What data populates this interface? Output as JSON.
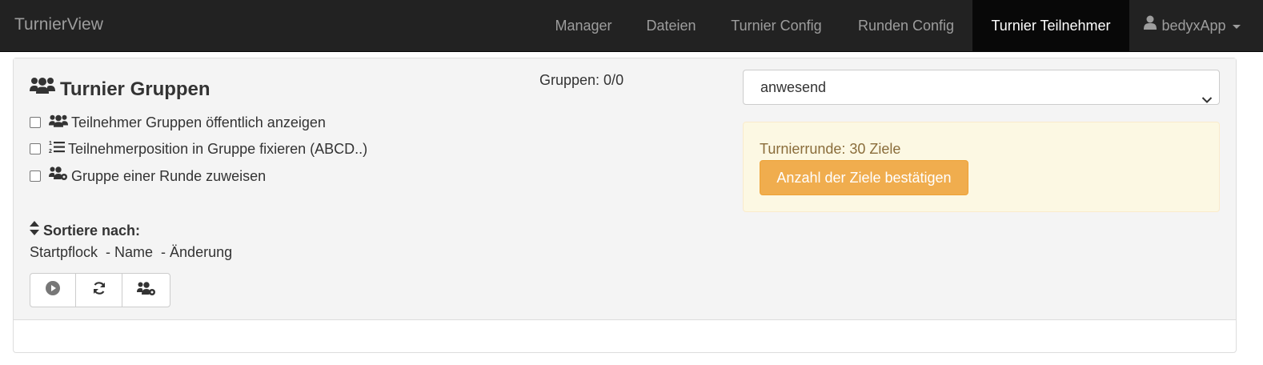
{
  "navbar": {
    "brand": "TurnierView",
    "items": [
      {
        "label": "Manager"
      },
      {
        "label": "Dateien"
      },
      {
        "label": "Turnier Config"
      },
      {
        "label": "Runden Config"
      },
      {
        "label": "Turnier Teilnehmer",
        "active": true
      }
    ],
    "user": {
      "label": "bedyxApp",
      "icon": "user-icon"
    }
  },
  "main": {
    "title": "Turnier Gruppen",
    "title_icon": "users-icon",
    "groups_count": "Gruppen: 0/0",
    "options": [
      {
        "label": "Teilnehmer Gruppen öffentlich anzeigen",
        "icon": "users-icon",
        "checked": false
      },
      {
        "label": "Teilnehmerposition in Gruppe fixieren (ABCD..)",
        "icon": "list-ordered-icon",
        "checked": false
      },
      {
        "label": "Gruppe einer Runde zuweisen",
        "icon": "users-gear-icon",
        "checked": false
      }
    ],
    "sort": {
      "heading": "Sortiere nach:",
      "line": "Startpflock  - Name  - Änderung"
    },
    "actions": [
      {
        "icon": "play-circle-icon"
      },
      {
        "icon": "refresh-icon"
      },
      {
        "icon": "users-gear-icon"
      }
    ],
    "status_select": {
      "value": "anwesend"
    },
    "alert": {
      "text": "Turnierrunde: 30 Ziele",
      "button": "Anzahl der Ziele bestätigen"
    }
  },
  "colors": {
    "navbar_bg": "#222222",
    "nav_active_bg": "#080808",
    "warning_button": "#f0ad4e",
    "alert_bg": "#fcf8e3",
    "alert_text": "#8a6d3b"
  }
}
